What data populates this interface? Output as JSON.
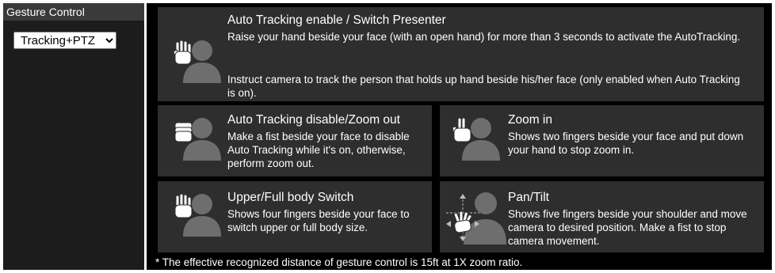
{
  "sidebar": {
    "title": "Gesture Control",
    "mode_select": {
      "selected": "Tracking+PTZ",
      "options": [
        "Tracking+PTZ"
      ]
    }
  },
  "cards": [
    {
      "title": "Auto Tracking enable / Switch Presenter",
      "desc1": "Raise your hand beside your face (with an open hand) for more than 3 seconds to activate the AutoTracking.",
      "desc2": "Instruct camera to track the person that holds up hand beside his/her face (only enabled when Auto Tracking is on).",
      "icon": "open-hand-person-icon"
    },
    {
      "title": "Auto Tracking disable/Zoom out",
      "desc": "Make a fist beside your face to disable Auto Tracking while it's on, otherwise, perform zoom out.",
      "icon": "fist-person-icon"
    },
    {
      "title": "Zoom in",
      "desc": "Shows two fingers beside your face and put down your hand to stop zoom in.",
      "icon": "two-fingers-person-icon"
    },
    {
      "title": "Upper/Full body Switch",
      "desc": "Shows four fingers beside your face to switch upper or full body size.",
      "icon": "four-fingers-person-icon"
    },
    {
      "title": "Pan/Tilt",
      "desc": "Shows five fingers beside your shoulder and move camera to desired position. Make a fist to stop camera movement.",
      "icon": "pan-tilt-hand-person-icon"
    }
  ],
  "footnote": "* The effective recognized distance of gesture control is 15ft at 1X zoom ratio."
}
